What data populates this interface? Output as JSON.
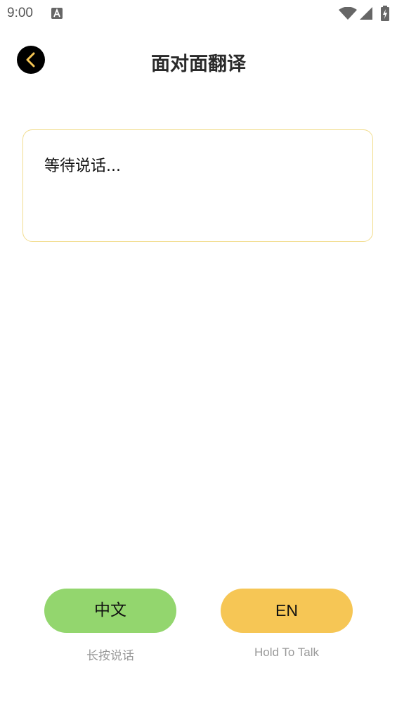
{
  "status_bar": {
    "time": "9:00",
    "icons": [
      "a-notification-icon",
      "wifi-icon",
      "signal-icon",
      "battery-charging-icon"
    ]
  },
  "header": {
    "title": "面对面翻译",
    "back_icon": "chevron-left-icon"
  },
  "transcript": {
    "text": "等待说话..."
  },
  "buttons": {
    "chinese": {
      "label": "中文",
      "hint": "长按说话"
    },
    "english": {
      "label": "EN",
      "hint": "Hold To Talk"
    }
  },
  "colors": {
    "accent_yellow": "#f6c655",
    "accent_green": "#93d66e",
    "box_border": "#f2dd8f",
    "back_chevron": "#f6c655"
  }
}
